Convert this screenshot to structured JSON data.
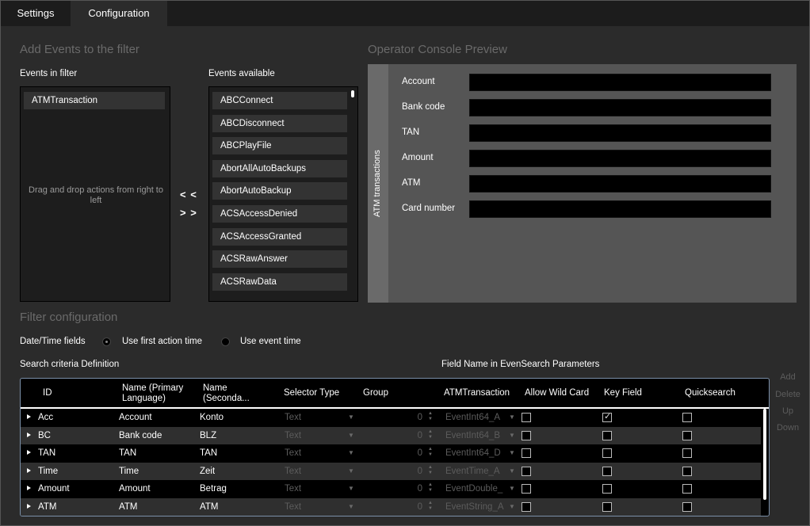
{
  "tabs": [
    {
      "label": "Settings"
    },
    {
      "label": "Configuration"
    }
  ],
  "add_events": {
    "title": "Add Events to the filter",
    "in_filter_label": "Events in filter",
    "available_label": "Events available",
    "in_filter_items": [
      "ATMTransaction"
    ],
    "drop_hint": "Drag and drop actions from right to left",
    "move_left": "< <",
    "move_right": "> >",
    "available_items": [
      "ABCConnect",
      "ABCDisconnect",
      "ABCPlayFile",
      "AbortAllAutoBackups",
      "AbortAutoBackup",
      "ACSAccessDenied",
      "ACSAccessGranted",
      "ACSRawAnswer",
      "ACSRawData"
    ]
  },
  "preview": {
    "title": "Operator Console Preview",
    "vertical_tab": "ATM transactions",
    "fields": [
      "Account",
      "Bank code",
      "TAN",
      "Amount",
      "ATM",
      "Card number"
    ]
  },
  "filter_config": {
    "title": "Filter configuration",
    "datetime_label": "Date/Time fields",
    "radio_first_action": "Use first action time",
    "radio_event_time": "Use event time",
    "search_criteria_label": "Search criteria Definition",
    "field_name_label": "Field Name in EvenSearch Parameters"
  },
  "grid": {
    "headers": {
      "id": "ID",
      "name_primary": "Name (Primary Language)",
      "name_secondary": "Name (Seconda...",
      "selector_type": "Selector Type",
      "group": "Group",
      "atm_transaction": "ATMTransaction",
      "allow_wild_card": "Allow Wild Card",
      "key_field": "Key Field",
      "quicksearch": "Quicksearch"
    },
    "rows": [
      {
        "id": "Acc",
        "name_primary": "Account",
        "name_secondary": "Konto",
        "selector": "Text",
        "group": "0",
        "field": "EventInt64_A",
        "wild": false,
        "key": true,
        "quick": false
      },
      {
        "id": "BC",
        "name_primary": "Bank code",
        "name_secondary": "BLZ",
        "selector": "Text",
        "group": "0",
        "field": "EventInt64_B",
        "wild": false,
        "key": false,
        "quick": false
      },
      {
        "id": "TAN",
        "name_primary": "TAN",
        "name_secondary": "TAN",
        "selector": "Text",
        "group": "0",
        "field": "EventInt64_D",
        "wild": false,
        "key": false,
        "quick": false
      },
      {
        "id": "Time",
        "name_primary": "Time",
        "name_secondary": "Zeit",
        "selector": "Text",
        "group": "0",
        "field": "EventTime_A",
        "wild": false,
        "key": false,
        "quick": false
      },
      {
        "id": "Amount",
        "name_primary": "Amount",
        "name_secondary": "Betrag",
        "selector": "Text",
        "group": "0",
        "field": "EventDouble_",
        "wild": false,
        "key": false,
        "quick": false
      },
      {
        "id": "ATM",
        "name_primary": "ATM",
        "name_secondary": "ATM",
        "selector": "Text",
        "group": "0",
        "field": "EventString_A",
        "wild": false,
        "key": false,
        "quick": false
      }
    ]
  },
  "side_buttons": {
    "add": "Add",
    "delete": "Delete",
    "up": "Up",
    "down": "Down"
  }
}
